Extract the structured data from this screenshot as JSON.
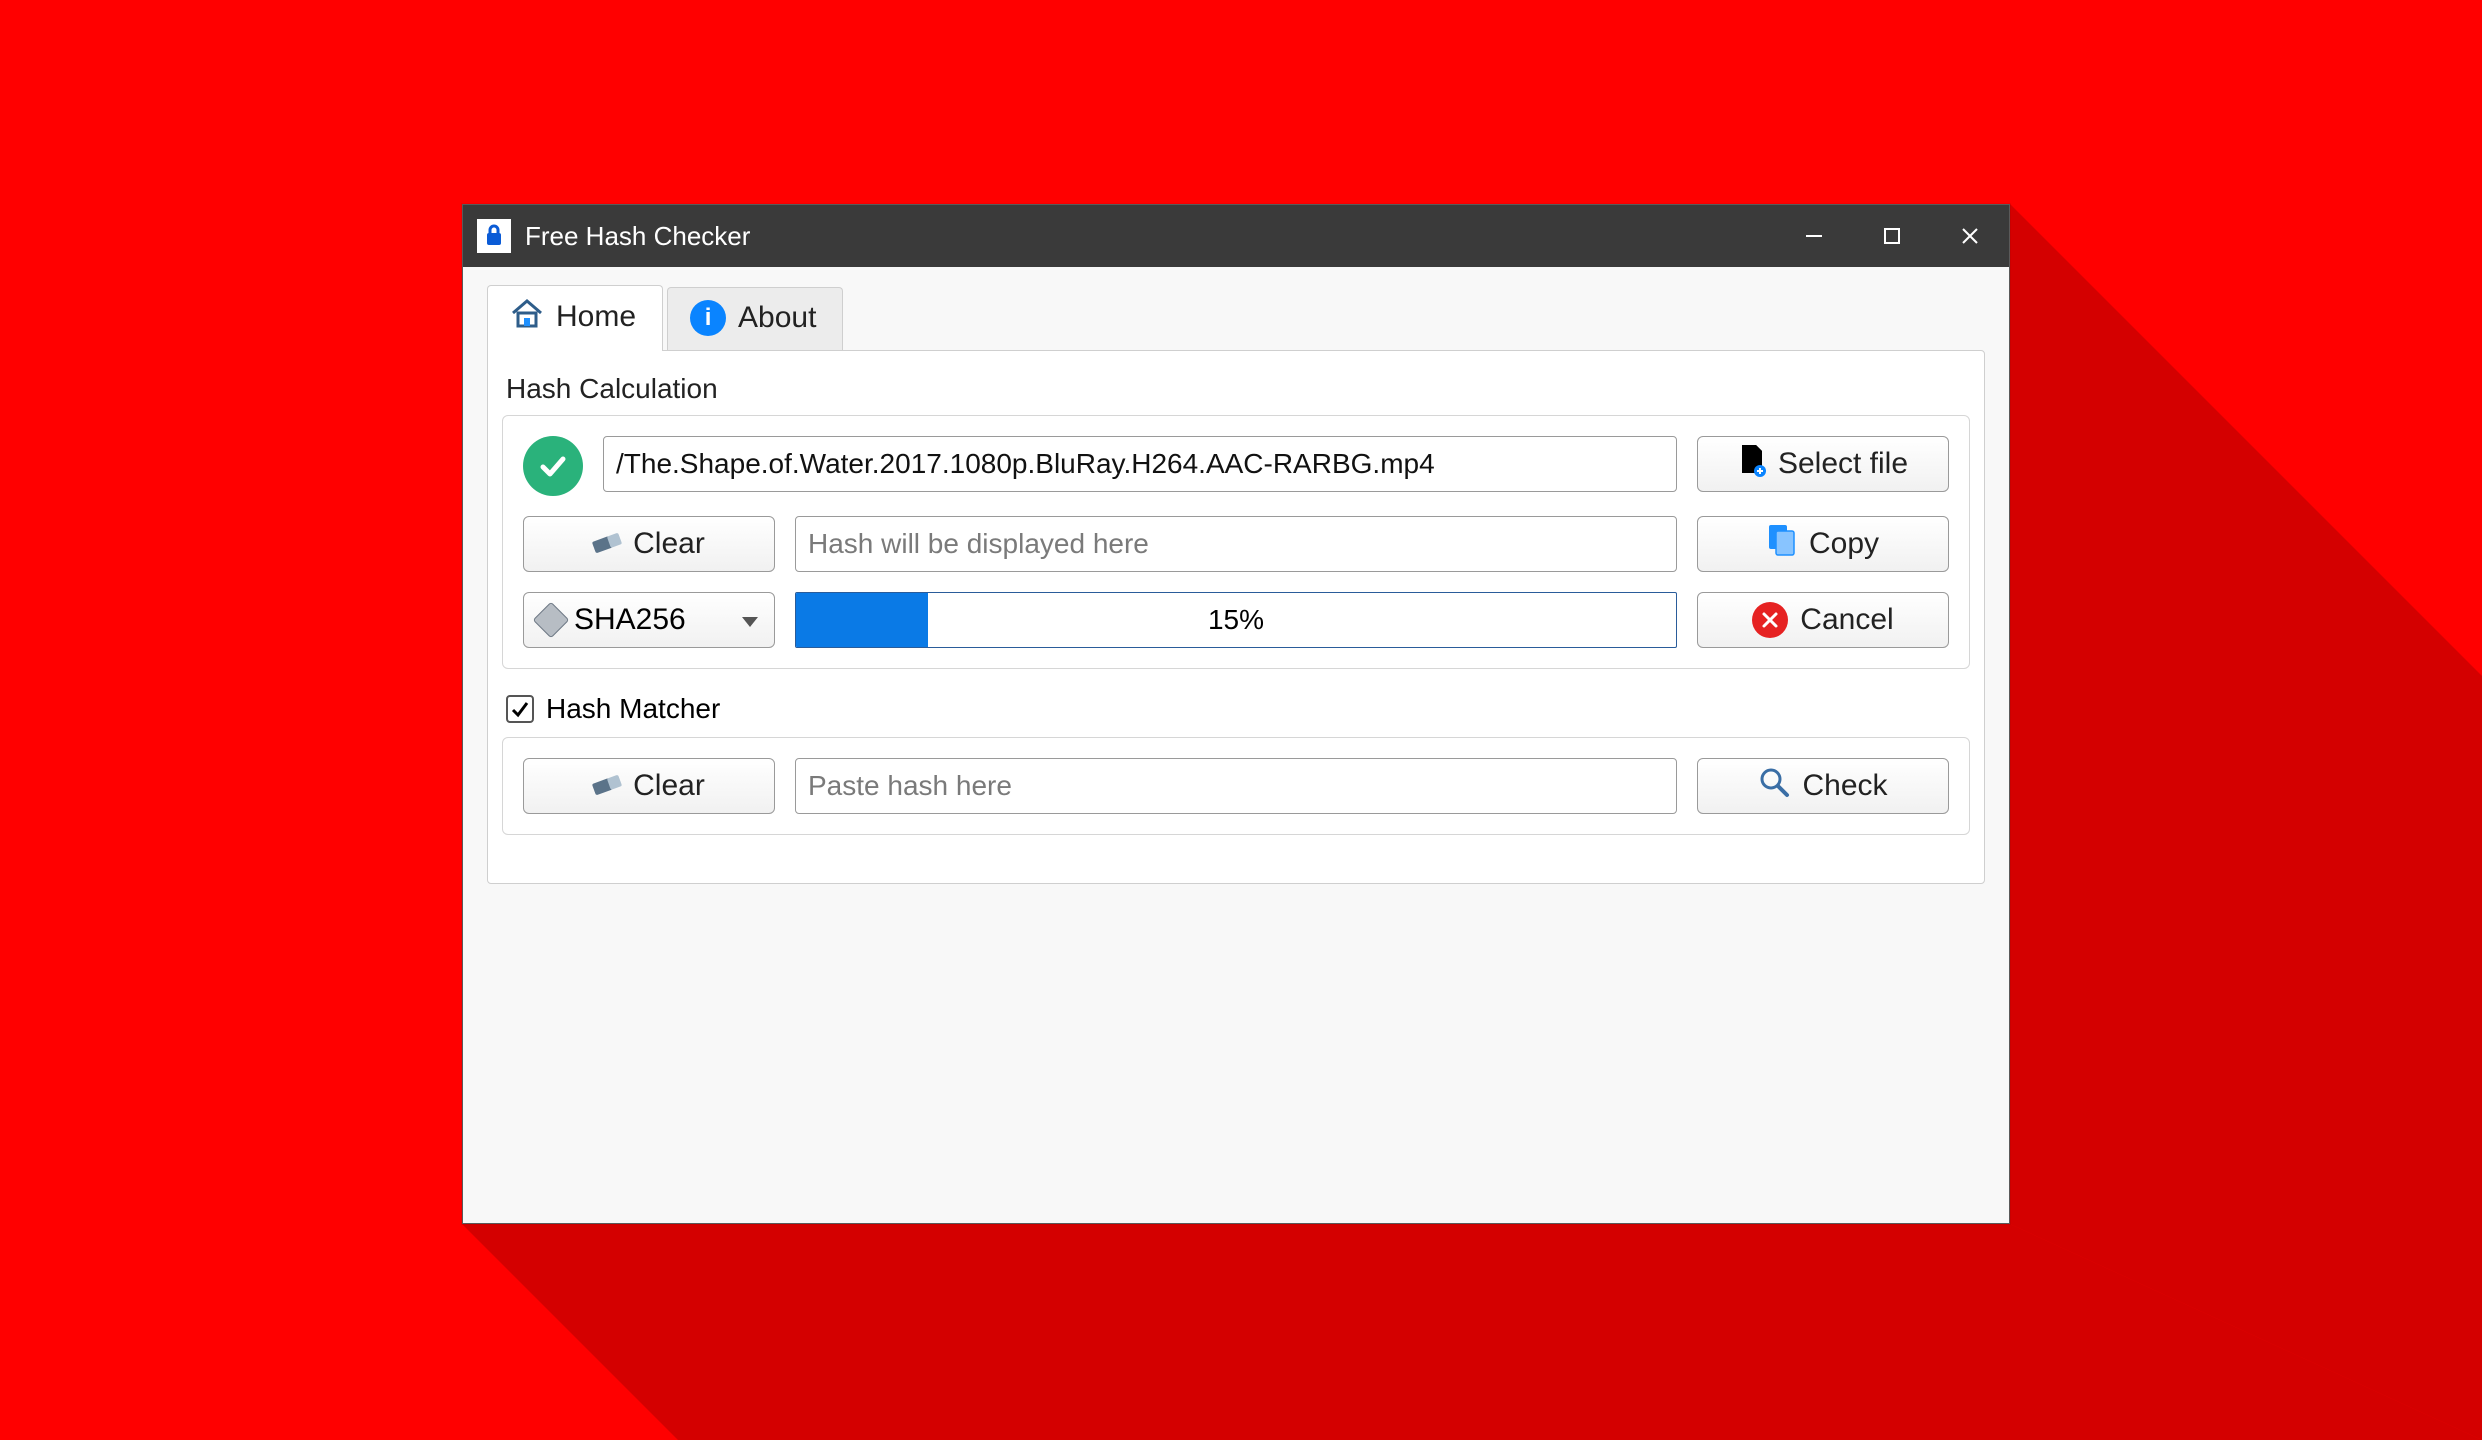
{
  "window": {
    "title": "Free Hash Checker"
  },
  "tabs": {
    "home": "Home",
    "about": "About"
  },
  "calc": {
    "group_label": "Hash Calculation",
    "file_path": "/The.Shape.of.Water.2017.1080p.BluRay.H264.AAC-RARBG.mp4",
    "select_file": "Select file",
    "clear": "Clear",
    "hash_placeholder": "Hash will be displayed here",
    "copy": "Copy",
    "algo_selected": "SHA256",
    "progress_pct": "15%",
    "progress_value": 15,
    "cancel": "Cancel"
  },
  "matcher": {
    "label": "Hash Matcher",
    "checked": true,
    "clear": "Clear",
    "paste_placeholder": "Paste hash here",
    "check": "Check"
  },
  "colors": {
    "accent_blue": "#0a7ae6",
    "status_green": "#2ab27b",
    "danger_red": "#e62222"
  }
}
